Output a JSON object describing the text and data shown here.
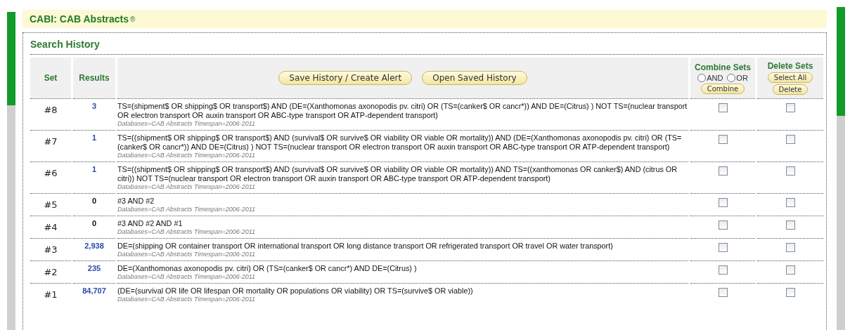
{
  "header": {
    "title": "CABI: CAB Abstracts",
    "mark": "®"
  },
  "panel": {
    "title": "Search History"
  },
  "table": {
    "columns": [
      "Set",
      "Results"
    ],
    "toolbar": [
      "Save History / Create Alert",
      "Open Saved History"
    ],
    "combine": {
      "title": "Combine Sets",
      "options": [
        {
          "label": "AND",
          "selected": false
        },
        {
          "label": "OR",
          "selected": false
        }
      ],
      "button": "Combine"
    },
    "delete": {
      "title": "Delete Sets",
      "buttons": [
        "Select All",
        "Delete"
      ]
    },
    "rows": [
      {
        "set": "#8",
        "results": "3",
        "query": "TS=(shipment$ OR shipping$ OR transport$) AND (DE=(Xanthomonas axonopodis pv. citri) OR (TS=(canker$ OR cancr*)) AND DE=(Citrus) ) NOT TS=(nuclear transport OR electron transport OR auxin transport OR ABC-type transport OR ATP-dependent transport)",
        "meta": "Databases=CAB Abstracts Timespan=2006-2011",
        "combine_checked": false,
        "delete_checked": false
      },
      {
        "set": "#7",
        "results": "1",
        "query": "TS=((shipment$ OR shipping$ OR transport$) AND (survival$ OR survive$ OR viability OR viable OR mortality)) AND (DE=(Xanthomonas axonopodis pv. citri) OR (TS=(canker$ OR cancr*)) AND DE=(Citrus) ) NOT TS=(nuclear transport OR electron transport OR auxin transport OR ABC-type transport OR ATP-dependent transport)",
        "meta": "Databases=CAB Abstracts Timespan=2006-2011",
        "combine_checked": false,
        "delete_checked": false
      },
      {
        "set": "#6",
        "results": "1",
        "query": "TS=((shipment$ OR shipping$ OR transport$) AND (survival$ OR survive$ OR viability OR viable OR mortality)) AND TS=((xanthomonas OR canker$) AND (citrus OR citri)) NOT TS=(nuclear transport OR electron transport OR auxin transport OR ABC-type transport OR ATP-dependent transport)",
        "meta": "Databases=CAB Abstracts Timespan=2006-2011",
        "combine_checked": false,
        "delete_checked": false
      },
      {
        "set": "#5",
        "results": "0",
        "query": "#3 AND #2",
        "meta": "Databases=CAB Abstracts Timespan=2006-2011",
        "combine_checked": false,
        "delete_checked": false
      },
      {
        "set": "#4",
        "results": "0",
        "query": "#3 AND #2 AND #1",
        "meta": "Databases=CAB Abstracts Timespan=2006-2011",
        "combine_checked": false,
        "delete_checked": false
      },
      {
        "set": "#3",
        "results": "2,938",
        "query": "DE=(shipping OR container transport OR international transport OR long distance transport OR refrigerated transport OR travel OR water transport)",
        "meta": "Databases=CAB Abstracts Timespan=2006-2011",
        "combine_checked": false,
        "delete_checked": false
      },
      {
        "set": "#2",
        "results": "235",
        "query": "DE=(Xanthomonas axonopodis pv. citri) OR (TS=(canker$ OR cancr*) AND DE=(Citrus) )",
        "meta": "Databases=CAB Abstracts Timespan=2006-2011",
        "combine_checked": false,
        "delete_checked": false
      },
      {
        "set": "#1",
        "results": "84,707",
        "query": "(DE=(survival OR life OR lifespan OR mortality OR populations OR viability) OR TS=(survive$ OR viable))",
        "meta": "Databases=CAB Abstracts Timespan=2006-2011",
        "combine_checked": false,
        "delete_checked": false
      }
    ]
  }
}
